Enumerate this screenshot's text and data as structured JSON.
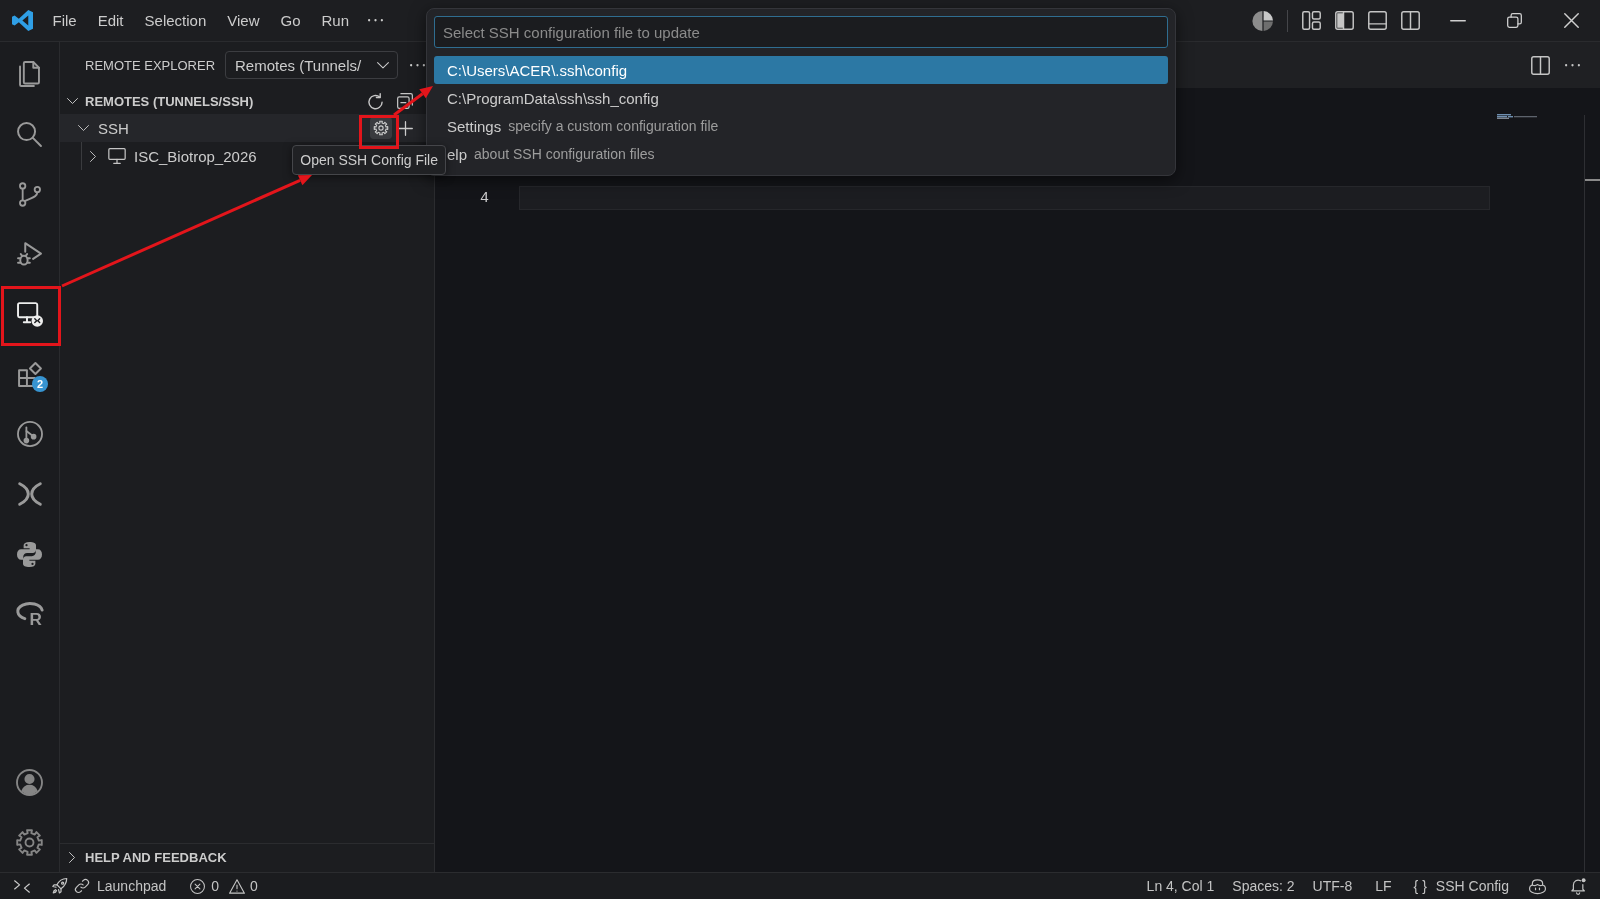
{
  "title_bar": {
    "menu": [
      {
        "label": "File"
      },
      {
        "label": "Edit"
      },
      {
        "label": "Selection"
      },
      {
        "label": "View"
      },
      {
        "label": "Go"
      },
      {
        "label": "Run"
      }
    ]
  },
  "activity_bar": {
    "items": [
      {
        "kind": "explorer",
        "selected": false
      },
      {
        "kind": "search",
        "selected": false
      },
      {
        "kind": "source-control",
        "selected": false
      },
      {
        "kind": "run-debug",
        "selected": false
      },
      {
        "kind": "remote-explorer",
        "selected": true
      },
      {
        "kind": "extensions",
        "selected": false,
        "badge": "2"
      },
      {
        "kind": "git-graph",
        "selected": false
      },
      {
        "kind": "crossed-curves",
        "selected": false
      },
      {
        "kind": "python",
        "selected": false
      },
      {
        "kind": "r-language",
        "selected": false,
        "glyph": "R"
      }
    ]
  },
  "sidebar": {
    "title": "REMOTE EXPLORER",
    "view_picker": {
      "value": "Remotes (Tunnels/"
    },
    "sections": [
      {
        "title": "REMOTES (TUNNELS/SSH)",
        "expanded": true,
        "tree": [
          {
            "label": "SSH",
            "expanded": true,
            "hovered": true,
            "children": [
              {
                "label": "ISC_Biotrop_2026",
                "expanded": false
              }
            ]
          }
        ]
      },
      {
        "title": "HELP AND FEEDBACK",
        "expanded": false
      }
    ]
  },
  "tooltip": {
    "text": "Open SSH Config File"
  },
  "quick_pick": {
    "placeholder": "Select SSH configuration file to update",
    "items": [
      {
        "label": "C:\\Users\\ACER\\.ssh\\config",
        "selected": true
      },
      {
        "label": "C:\\ProgramData\\ssh\\ssh_config",
        "selected": false
      },
      {
        "label": "Settings",
        "description": "specify a custom configuration file",
        "selected": false
      },
      {
        "label": "elp",
        "description": "about SSH configuration files",
        "selected": false
      }
    ]
  },
  "editor": {
    "lines": [
      {
        "number": "4",
        "current": true
      }
    ]
  },
  "status_bar": {
    "launchpad": "Launchpad",
    "errors": "0",
    "warnings": "0",
    "cursor": "Ln 4, Col 1",
    "indentation": "Spaces: 2",
    "encoding": "UTF-8",
    "line_ending": "LF",
    "language_icon": "{ }",
    "language": "SSH Config"
  }
}
